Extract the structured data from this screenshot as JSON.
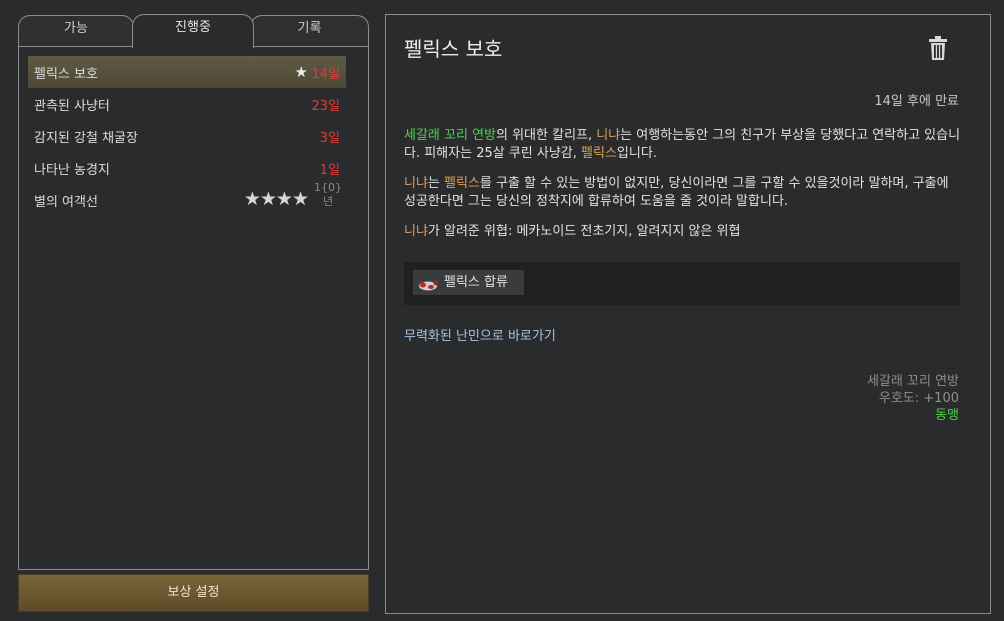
{
  "tabs": [
    {
      "label": "가능"
    },
    {
      "label": "진행중",
      "active": true
    },
    {
      "label": "기록"
    }
  ],
  "quests": [
    {
      "name": "펠릭스 보호",
      "time": "14일",
      "starred": true,
      "selected": true
    },
    {
      "name": "관측된 사냥터",
      "time": "23일"
    },
    {
      "name": "감지된 강철 채굴장",
      "time": "3일"
    },
    {
      "name": "나타난 농경지",
      "time": "1일"
    },
    {
      "name": "별의 여객선",
      "stars": "★★★★",
      "time_top": "1{0}",
      "time_bottom": "년"
    }
  ],
  "reward_button": "보상 설정",
  "detail": {
    "title": "펠릭스 보호",
    "expire": "14일 후에 만료",
    "p1": {
      "faction": "세갈래 꼬리 연방",
      "t1": "의 위대한 칼리프, ",
      "asker": "니냐",
      "t2": "는 여행하는동안 그의 친구가 부상을 당했다고 연락하고 있습니다. 피해자는 25살 쿠린 사냥감, ",
      "victim": "펠릭스",
      "t3": "입니다."
    },
    "p2": {
      "asker": "니냐",
      "t1": "는 ",
      "victim": "펠릭스",
      "t2": "를 구출 할 수 있는 방법이 없지만, 당신이라면 그를 구할 수 있을것이라 말하며, 구출에 성공한다면 그는 당신의 정착지에 합류하여 도움을 줄 것이라 말합니다."
    },
    "p3": {
      "asker": "니냐",
      "t1": "가 알려준 위협: 메카노이드 전초기지, 알려지지 않은 위협"
    },
    "reward_item": "펠릭스 합류",
    "link": "무력화된 난민으로 바로가기",
    "faction_name": "세갈래 꼬리 연방",
    "goodwill": "우호도: +100",
    "relation": "동맹"
  },
  "colors": {
    "accent_red": "#e23b3b",
    "faction_green": "#4fd04f",
    "pawn_orange": "#e0a153",
    "link_blue": "#a9c2e3"
  },
  "icons": [
    "star-icon",
    "trash-icon",
    "pawn-icon"
  ]
}
